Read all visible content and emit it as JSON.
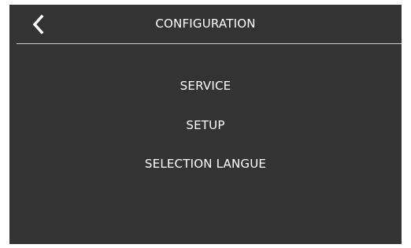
{
  "header": {
    "back_icon": "chevron-left-icon",
    "title": "CONFIGURATION"
  },
  "menu": {
    "items": [
      {
        "label": "SERVICE"
      },
      {
        "label": "SETUP"
      },
      {
        "label": "SELECTION LANGUE"
      }
    ]
  },
  "colors": {
    "background": "#333333",
    "text": "#ffffff",
    "divider": "#cfcfcf"
  }
}
